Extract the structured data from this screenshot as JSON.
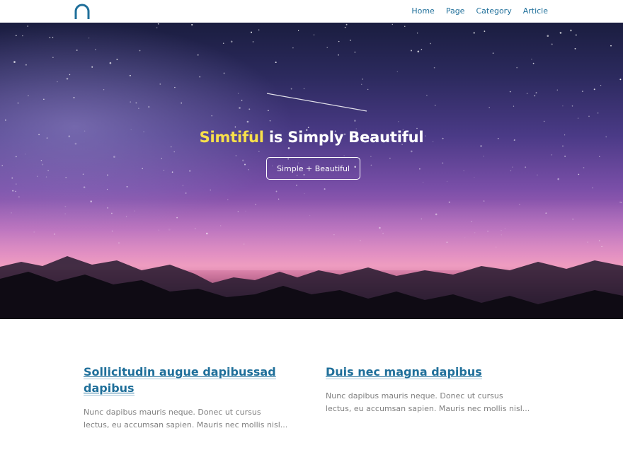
{
  "header": {
    "logo_icon": "arch-logo-icon",
    "nav": [
      "Home",
      "Page",
      "Category",
      "Article"
    ]
  },
  "hero": {
    "title_accent": "Simtiful",
    "title_rest": " is Simply Beautiful",
    "button_label": "Simple + Beautiful"
  },
  "posts": [
    {
      "title": "Sollicitudin augue dapibussad dapibus",
      "excerpt": "Nunc dapibus mauris neque. Donec ut cursus lectus, eu accumsan sapien. Mauris nec mollis nisl..."
    },
    {
      "title": "Duis nec magna dapibus",
      "excerpt": "Nunc dapibus mauris neque. Donec ut cursus lectus, eu accumsan sapien. Mauris nec mollis nisl..."
    }
  ],
  "colors": {
    "link": "#1f6f9a",
    "accent_yellow": "#f8e04a"
  }
}
